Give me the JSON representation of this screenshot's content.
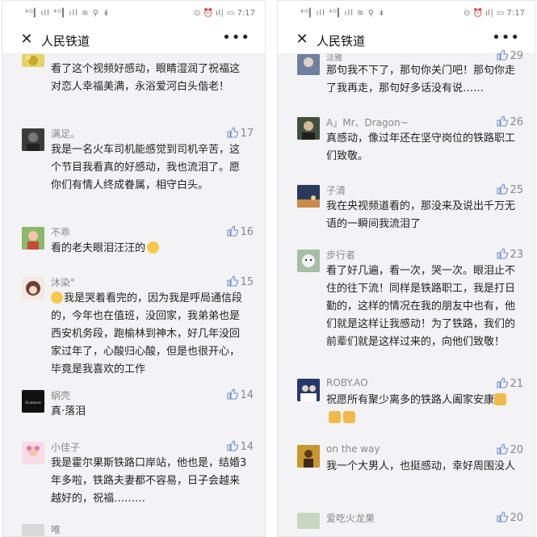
{
  "status_left": "⁴ᴳ▎ıll ⁴ᴳ▎ıll ≋ ⚲ ↡",
  "status_right": "⊙ ⏰ ıl∣ ▭ 7:17",
  "nav": {
    "title": "人民铁道",
    "close": "✕",
    "more": "•••"
  },
  "left_comments": [
    {
      "user": "",
      "likes": "",
      "text": "看了这个视频好感动，眼睛湿润了祝福这对恋人幸福美满，永浴爱河白头偕老！"
    },
    {
      "user": "满足。",
      "likes": "17",
      "text": "我是一名火车司机能感觉到司机辛苦，这个节目我看真的好感动，我也流泪了。愿你们有情人终成眷属，相守白头。"
    },
    {
      "user": "不乖",
      "likes": "16",
      "text": "看的老夫眼泪汪汪的"
    },
    {
      "user": "沐染°",
      "likes": "15",
      "text": "我是哭着看完的，因为我是呼局通信段的，今年也在值班，没回家，我弟弟也是西安机务段，跑榆林到神木，好几年没回家过年了，心酸归心酸，但是也很开心，毕竟是我喜欢的工作"
    },
    {
      "user": "蜗壳",
      "likes": "14",
      "text": "真·落泪"
    },
    {
      "user": "小佳子",
      "likes": "14",
      "text": "我是霍尔果斯铁路口岸站，他也是，结婚3年多啦，铁路夫妻都不容易，日子会越来越好的，祝福………"
    },
    {
      "user": "唯",
      "likes": "",
      "text": ""
    }
  ],
  "right_comments": [
    {
      "user": "淡雅",
      "likes": "29",
      "text": "那句我不下了，那句你关门吧！那句你走了我再走，那句好多话没有说……"
    },
    {
      "user": "A」Mr、Dragon~",
      "likes": "26",
      "text": "真感动，像过年还在坚守岗位的铁路职工们致敬。"
    },
    {
      "user": "子清",
      "likes": "25",
      "text": "我在央视频道看的，那没来及说出千万无语的一瞬间我流泪了"
    },
    {
      "user": "步行者",
      "likes": "23",
      "text": "看了好几遍，看一次，哭一次。眼泪止不住的往下流！同样是铁路职工，我是打日勤的，这样的情况在我的朋友中也有，他们就是这样让我感动！为了铁路，我们的前辈们就是这样过来的，向他们致敬！"
    },
    {
      "user": "ROBY.AO",
      "likes": "21",
      "text": "祝愿所有聚少离多的铁路人阖家安康"
    },
    {
      "user": "on the way",
      "likes": "20",
      "text": "我一个大男人，也挺感动，幸好周围没人"
    },
    {
      "user": "爱吃火龙果",
      "likes": "20",
      "text": ""
    }
  ],
  "colors": {
    "bg": "#f3f3f5",
    "text": "#222222",
    "meta": "#888888"
  },
  "icons": [
    "close-icon",
    "more-icon",
    "thumb-up-icon"
  ]
}
